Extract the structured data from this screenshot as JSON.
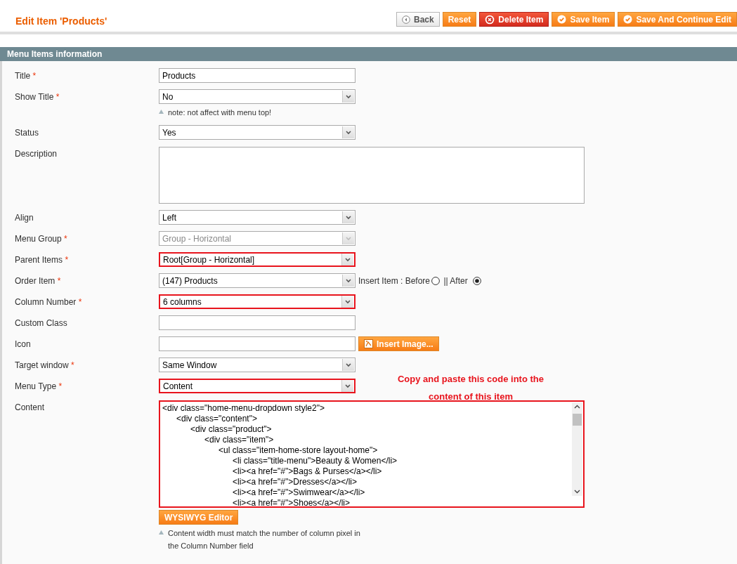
{
  "page_title": "Edit Item 'Products'",
  "buttons": [
    {
      "label": "Back",
      "kind": "back"
    },
    {
      "label": "Reset",
      "kind": "plain"
    },
    {
      "label": "Delete Item",
      "kind": "delete"
    },
    {
      "label": "Save Item",
      "kind": "save"
    },
    {
      "label": "Save And Continue Edit",
      "kind": "save"
    }
  ],
  "section_title": "Menu Items information",
  "fields": [
    {
      "label": "Title",
      "asterisk": "*",
      "kind": "text",
      "value": "Products",
      "highlighted": false
    },
    {
      "label": "Show Title",
      "asterisk": "*",
      "kind": "select",
      "value": "No",
      "highlighted": false,
      "disabled": false,
      "note": "note: not affect with menu top!"
    },
    {
      "label": "Status",
      "kind": "select",
      "value": "Yes",
      "highlighted": false,
      "disabled": false
    },
    {
      "label": "Description",
      "kind": "textarea",
      "highlighted": false
    },
    {
      "label": "Align",
      "kind": "select",
      "value": "Left",
      "highlighted": false,
      "disabled": false
    },
    {
      "label": "Menu Group",
      "asterisk": "*",
      "kind": "select",
      "value": "Group - Horizontal",
      "highlighted": false,
      "disabled": true
    },
    {
      "label": "Parent Items",
      "asterisk": "*",
      "kind": "select",
      "value": "Root[Group - Horizontal]",
      "highlighted": true,
      "disabled": false
    },
    {
      "label": "Order Item",
      "asterisk": "*",
      "kind": "select",
      "value": "(147) Products",
      "highlighted": false,
      "disabled": false,
      "insert": {
        "label": "Insert Item : Before",
        "separator": "|| After",
        "before_selected": false,
        "after_selected": true
      }
    },
    {
      "label": "Column Number",
      "asterisk": "*",
      "kind": "select",
      "value": "6 columns",
      "highlighted": true,
      "disabled": false
    },
    {
      "label": "Custom Class",
      "kind": "text",
      "highlighted": false
    },
    {
      "label": "Icon",
      "kind": "text",
      "highlighted": false,
      "action": "Insert Image..."
    },
    {
      "label": "Target window",
      "asterisk": "*",
      "kind": "select",
      "value": "Same Window",
      "highlighted": false,
      "disabled": false
    },
    {
      "label": "Menu Type",
      "asterisk": "*",
      "kind": "select",
      "value": "Content",
      "highlighted": true,
      "disabled": false
    },
    {
      "label": "Content",
      "kind": "code",
      "highlighted": true,
      "lines": [
        "<div class=\"home-menu-dropdown style2\">",
        "\t<div class=\"content\">",
        "\t\t<div class=\"product\">",
        "\t\t\t<div class=\"item\">",
        "\t\t\t\t<ul class=\"item-home-store layout-home\">",
        "\t\t\t\t\t<li class=\"title-menu\">Beauty & Women</li>",
        "\t\t\t\t\t<li><a href=\"#\">Bags & Purses</a></li>",
        "\t\t\t\t\t<li><a href=\"#\">Dresses</a></li>",
        "\t\t\t\t\t<li><a href=\"#\">Swimwear</a></li>",
        "\t\t\t\t\t<li><a href=\"#\">Shoes</a></li>"
      ],
      "action": "WYSIWYG Editor",
      "note": "Content width must match the number of column pixel in the Column Number field"
    }
  ],
  "annotation": "Copy and paste this code into the content of this item"
}
